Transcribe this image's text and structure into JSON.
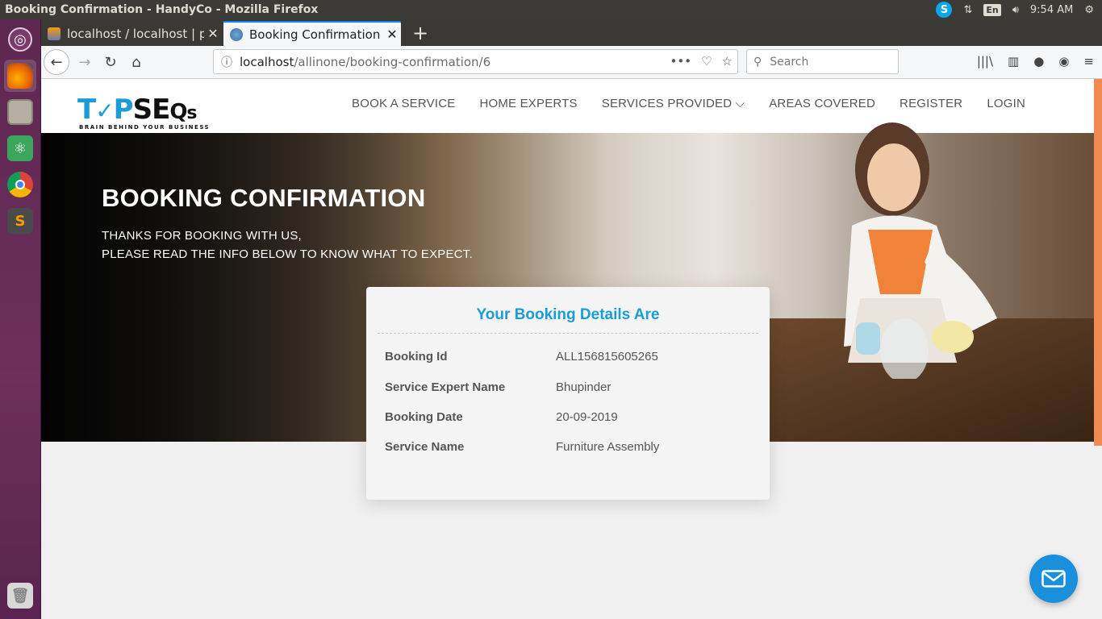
{
  "window": {
    "title": "Booking Confirmation - HandyCo - Mozilla Firefox"
  },
  "tray": {
    "lang": "En",
    "time": "9:54 AM"
  },
  "launcher": {
    "items": [
      "ubuntu-dash",
      "firefox",
      "files",
      "atom",
      "chrome",
      "sublime-text",
      "trash"
    ]
  },
  "tabs": [
    {
      "label": "localhost / localhost | ph",
      "close": "✕"
    },
    {
      "label": "Booking Confirmation - ",
      "close": "✕"
    }
  ],
  "newtab": "+",
  "urlbar": {
    "host": "localhost",
    "path": "/allinone/booking-confirmation/6",
    "info": "ⓘ"
  },
  "search": {
    "placeholder": "Search"
  },
  "site": {
    "logo": {
      "part1": "T",
      "part2": "P",
      "part3": "SE",
      "part4": "s",
      "tagline": "BRAIN BEHIND YOUR BUSINESS"
    },
    "menu": [
      {
        "label": "BOOK A SERVICE"
      },
      {
        "label": "HOME EXPERTS"
      },
      {
        "label": "SERVICES PROVIDED ⌵"
      },
      {
        "label": "AREAS COVERED"
      },
      {
        "label": "REGISTER"
      },
      {
        "label": "LOGIN"
      }
    ],
    "hero": {
      "title": "BOOKING CONFIRMATION",
      "line1": "THANKS FOR BOOKING WITH US,",
      "line2": "PLEASE READ THE INFO BELOW TO KNOW WHAT TO EXPECT."
    },
    "card": {
      "title": "Your Booking Details Are",
      "rows": [
        {
          "label": "Booking Id",
          "value": "ALL156815605265"
        },
        {
          "label": "Service Expert Name",
          "value": "Bhupinder"
        },
        {
          "label": "Booking Date",
          "value": "20-09-2019"
        },
        {
          "label": "Service Name",
          "value": "Furniture Assembly"
        }
      ]
    }
  },
  "colors": {
    "accent": "#1a9cd8",
    "ubuntu_launcher": "#5e2750",
    "scrollbar": "#f08a52"
  }
}
